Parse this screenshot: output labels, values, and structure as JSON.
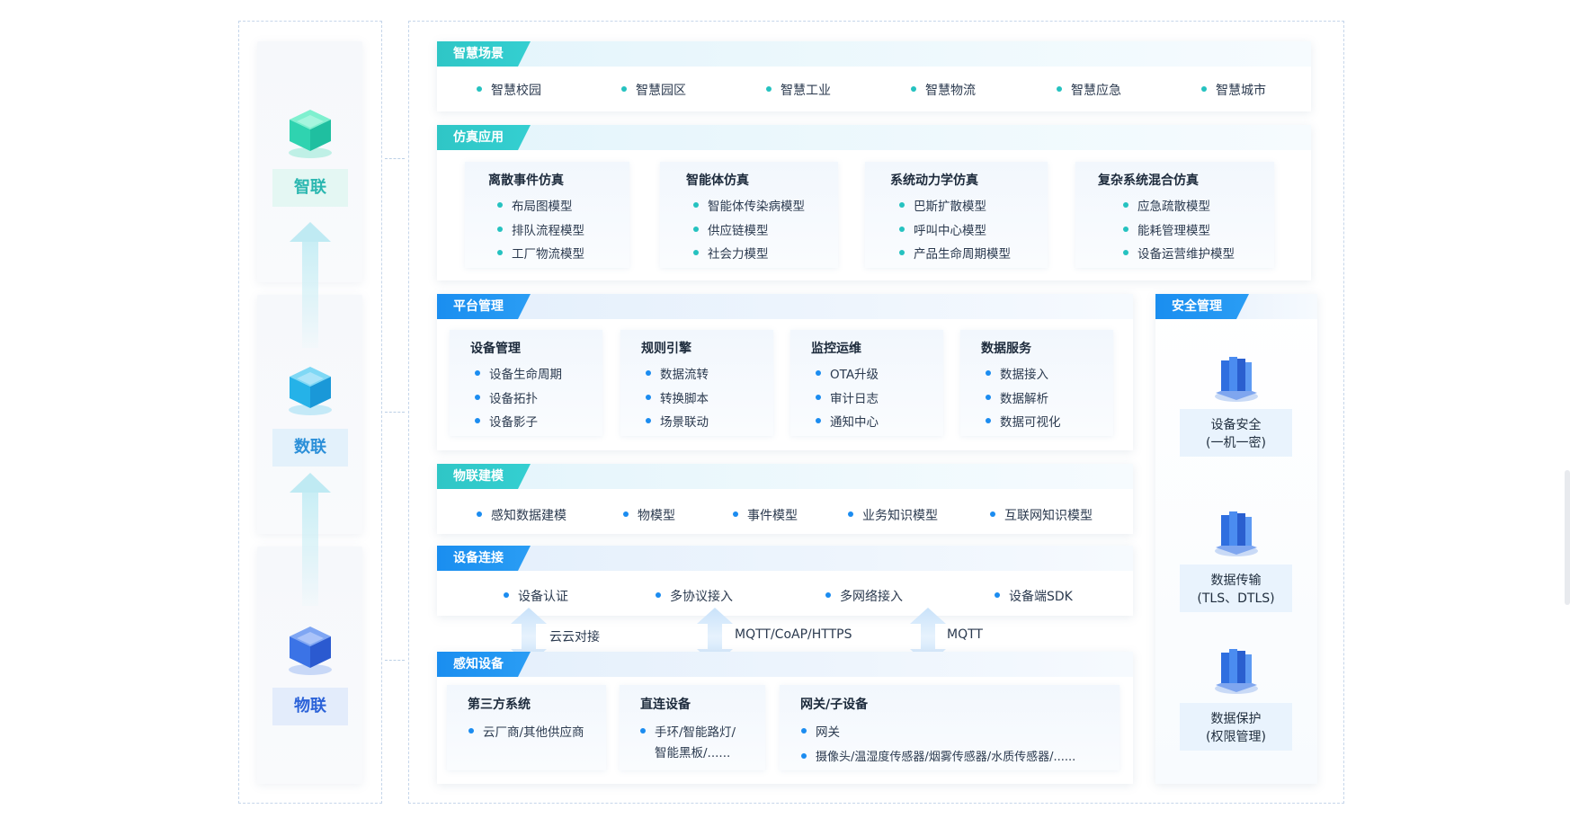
{
  "left": {
    "zhilian": "智联",
    "shulian": "数联",
    "wulian": "物联"
  },
  "sections": {
    "scene": {
      "tag": "智慧场景",
      "items": [
        "智慧校园",
        "智慧园区",
        "智慧工业",
        "智慧物流",
        "智慧应急",
        "智慧城市"
      ]
    },
    "sim": {
      "tag": "仿真应用",
      "cards": [
        {
          "title": "离散事件仿真",
          "items": [
            "布局图模型",
            "排队流程模型",
            "工厂物流模型"
          ]
        },
        {
          "title": "智能体仿真",
          "items": [
            "智能体传染病模型",
            "供应链模型",
            "社会力模型"
          ]
        },
        {
          "title": "系统动力学仿真",
          "items": [
            "巴斯扩散模型",
            "呼叫中心模型",
            "产品生命周期模型"
          ]
        },
        {
          "title": "复杂系统混合仿真",
          "items": [
            "应急疏散模型",
            "能耗管理模型",
            "设备运营维护模型"
          ]
        }
      ]
    },
    "platform": {
      "tag": "平台管理",
      "cards": [
        {
          "title": "设备管理",
          "items": [
            "设备生命周期",
            "设备拓扑",
            "设备影子"
          ]
        },
        {
          "title": "规则引擎",
          "items": [
            "数据流转",
            "转换脚本",
            "场景联动"
          ]
        },
        {
          "title": "监控运维",
          "items": [
            "OTA升级",
            "审计日志",
            "通知中心"
          ]
        },
        {
          "title": "数据服务",
          "items": [
            "数据接入",
            "数据解析",
            "数据可视化"
          ]
        }
      ]
    },
    "model": {
      "tag": "物联建模",
      "items": [
        "感知数据建模",
        "物模型",
        "事件模型",
        "业务知识模型",
        "互联网知识模型"
      ]
    },
    "connect": {
      "tag": "设备连接",
      "items": [
        "设备认证",
        "多协议接入",
        "多网络接入",
        "设备端SDK"
      ]
    },
    "protocols": [
      "云云对接",
      "MQTT/CoAP/HTTPS",
      "MQTT"
    ],
    "sense": {
      "tag": "感知设备",
      "cards": [
        {
          "title": "第三方系统",
          "items": [
            "云厂商/其他供应商"
          ]
        },
        {
          "title": "直连设备",
          "items": [
            "手环/智能路灯/",
            "智能黑板/......"
          ]
        },
        {
          "title": "网关/子设备",
          "items": [
            "网关",
            "摄像头/温湿度传感器/烟雾传感器/水质传感器/......"
          ]
        }
      ]
    },
    "security": {
      "tag": "安全管理",
      "items": [
        {
          "line1": "设备安全",
          "line2": "(一机一密)"
        },
        {
          "line1": "数据传输",
          "line2": "(TLS、DTLS)"
        },
        {
          "line1": "数据保护",
          "line2": "(权限管理)"
        }
      ]
    }
  },
  "colors": {
    "teal": "#2fc6c6",
    "blue": "#1a8ef0",
    "zhilian_text": "#2bb7b0",
    "shulian_text": "#2b8fd8",
    "wulian_text": "#2b62d8"
  }
}
